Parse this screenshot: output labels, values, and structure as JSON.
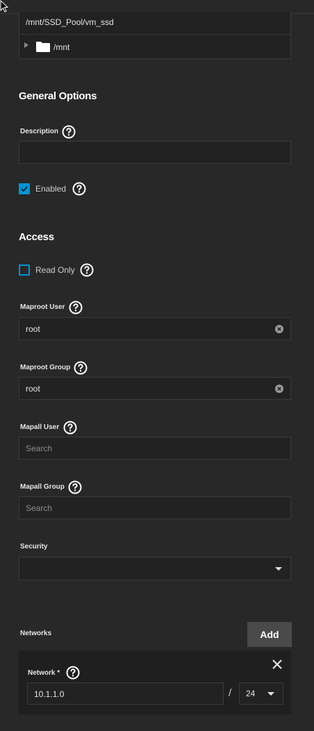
{
  "tree": {
    "selected_path": "/mnt/SSD_Pool/vm_ssd",
    "node_label": "/mnt"
  },
  "general": {
    "title": "General Options",
    "description_label": "Description",
    "description_value": "",
    "enabled_label": "Enabled",
    "enabled_checked": true
  },
  "access": {
    "title": "Access",
    "readonly_label": "Read Only",
    "readonly_checked": false,
    "maproot_user_label": "Maproot User",
    "maproot_user_value": "root",
    "maproot_group_label": "Maproot Group",
    "maproot_group_value": "root",
    "mapall_user_label": "Mapall User",
    "mapall_user_placeholder": "Search",
    "mapall_group_label": "Mapall Group",
    "mapall_group_placeholder": "Search",
    "security_label": "Security",
    "security_value": ""
  },
  "networks": {
    "label": "Networks",
    "add_label": "Add",
    "items": [
      {
        "label": "Network *",
        "address": "10.1.1.0",
        "slash": "/",
        "mask": "24"
      }
    ]
  },
  "colors": {
    "accent": "#0095d5",
    "background": "#282828",
    "field": "#222222"
  }
}
